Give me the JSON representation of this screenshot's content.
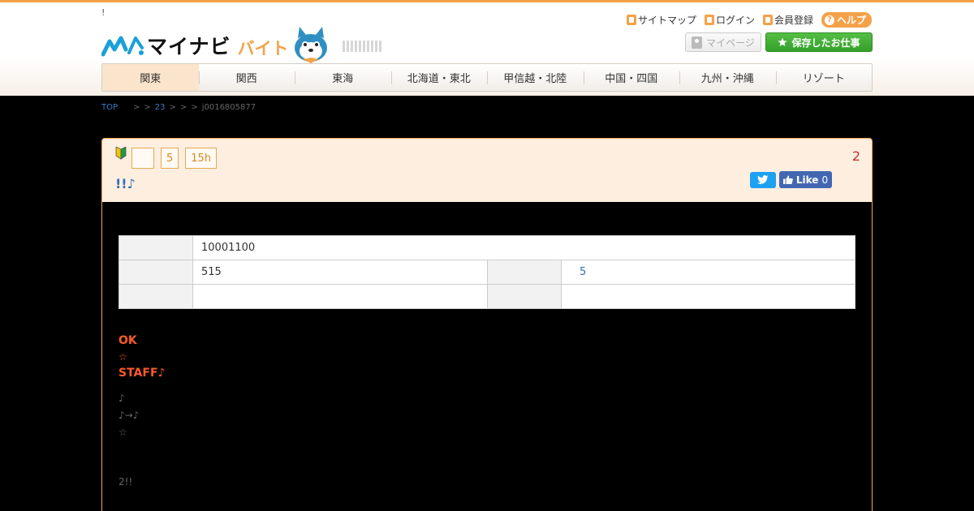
{
  "header": {
    "tagline": "!",
    "logo_text": "マイナビ",
    "logo_sub": "バイト",
    "links": {
      "sitemap": "サイトマップ",
      "login": "ログイン",
      "register": "会員登録",
      "help": "ヘルプ"
    },
    "mypage_label": "マイページ",
    "saved_jobs_label": "保存したお仕事",
    "brand_color": "#f3a24a",
    "green_color": "#3caa30"
  },
  "nav": {
    "items": [
      "関東",
      "関西",
      "東海",
      "北海道・東北",
      "甲信越・北陸",
      "中国・四国",
      "九州・沖縄",
      "リゾート"
    ],
    "active_index": 0
  },
  "breadcrumb": {
    "top": "TOP",
    "sep1": ">",
    "sep2": ">",
    "count_link": "23",
    "sep3": ">",
    "sep4": ">",
    "sep5": ">",
    "job_id": "j0016805877"
  },
  "job": {
    "badges": [
      "",
      "5",
      "15h"
    ],
    "title": "!!♪",
    "number": "2",
    "fb_like": "Like",
    "fb_count": "0",
    "table": {
      "row1_value": "10001100",
      "row2_value": "515",
      "row2_right_value": "5",
      "row3_value": "",
      "row3_right_value": ""
    },
    "catch_line1": "OK",
    "catch_line2": "☆",
    "catch_line3": "STAFF♪",
    "desc_line1": "♪",
    "desc_line2": "♪→♪",
    "desc_line3": "☆",
    "desc_line4": "2!!"
  }
}
